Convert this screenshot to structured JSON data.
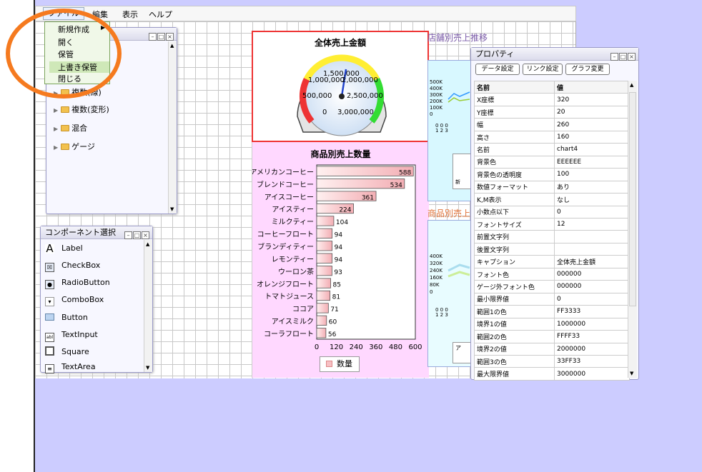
{
  "menubar": {
    "items": [
      "ファイル",
      "編集",
      "表示",
      "ヘルプ"
    ]
  },
  "file_menu": {
    "items": [
      "新規作成",
      "開く",
      "保管",
      "上書き保管",
      "閉じる"
    ],
    "submenu_arrow": "▶"
  },
  "tree_panel": {
    "items": [
      "複数(線)",
      "複数(変形)",
      "混合",
      "ゲージ"
    ]
  },
  "component_panel": {
    "title": "コンポーネント選択",
    "items": [
      {
        "icon": "label-icon",
        "label": "Label"
      },
      {
        "icon": "checkbox-icon",
        "label": "CheckBox"
      },
      {
        "icon": "radiobutton-icon",
        "label": "RadioButton"
      },
      {
        "icon": "combobox-icon",
        "label": "ComboBox"
      },
      {
        "icon": "button-icon",
        "label": "Button"
      },
      {
        "icon": "textinput-icon",
        "label": "TextInput"
      },
      {
        "icon": "square-icon",
        "label": "Square"
      },
      {
        "icon": "textarea-icon",
        "label": "TextArea"
      }
    ]
  },
  "gauge_chart": {
    "title": "全体売上金額",
    "labels": [
      "1,500,000",
      "1,000,000",
      "2,000,000",
      "500,000",
      "2,500,000",
      "0",
      "3,000,000"
    ]
  },
  "bar_chart_title": "商品別売上数量",
  "side_titles": {
    "store_trend": "店舗別売上推移",
    "product_sales": "商品別売上"
  },
  "mini_axis_1": [
    "500K",
    "400K",
    "300K",
    "200K",
    "100K",
    "0"
  ],
  "mini_axis_2": [
    "400K",
    "320K",
    "240K",
    "160K",
    "80K",
    "0"
  ],
  "mini_x_1": "0 0 0 1 2 3",
  "legend_fragment_1": "新",
  "legend_fragment_2": "ア",
  "chart_data": {
    "type": "bar",
    "orientation": "horizontal",
    "title": "商品別売上数量",
    "categories": [
      "アメリカンコーヒー",
      "ブレンドコーヒー",
      "アイスコーヒー",
      "アイスティー",
      "ミルクティー",
      "コーヒーフロート",
      "ブランディティー",
      "レモンティー",
      "ウーロン茶",
      "オレンジフロート",
      "トマトジュース",
      "ココア",
      "アイスミルク",
      "コーラフロート"
    ],
    "series": [
      {
        "name": "数量",
        "values": [
          588,
          534,
          361,
          224,
          104,
          94,
          94,
          94,
          93,
          85,
          81,
          71,
          60,
          56
        ]
      }
    ],
    "xlim": [
      0,
      600
    ],
    "xticks": [
      "0",
      "120",
      "240",
      "360",
      "480",
      "600"
    ],
    "legend": "bottom-center",
    "colors": {
      "bar_start": "#fff0f0",
      "bar_end": "#f3aeb4"
    }
  },
  "properties": {
    "title": "プロパティ",
    "buttons": [
      "データ設定",
      "リンク設定",
      "グラフ変更"
    ],
    "headers": [
      "名前",
      "値"
    ],
    "rows": [
      [
        "X座標",
        "320"
      ],
      [
        "Y座標",
        "20"
      ],
      [
        "幅",
        "260"
      ],
      [
        "高さ",
        "160"
      ],
      [
        "名前",
        "chart4"
      ],
      [
        "背景色",
        "EEEEEE"
      ],
      [
        "背景色の透明度",
        "100"
      ],
      [
        "数値フォーマット",
        "あり"
      ],
      [
        "K,M表示",
        "なし"
      ],
      [
        "小数点以下",
        "0"
      ],
      [
        "フォントサイズ",
        "12"
      ],
      [
        "前置文字列",
        ""
      ],
      [
        "後置文字列",
        ""
      ],
      [
        "キャプション",
        "全体売上金額"
      ],
      [
        "フォント色",
        "000000"
      ],
      [
        "ゲージ外フォント色",
        "000000"
      ],
      [
        "最小限界値",
        "0"
      ],
      [
        "範囲1の色",
        "FF3333"
      ],
      [
        "境界1の値",
        "1000000"
      ],
      [
        "範囲2の色",
        "FFFF33"
      ],
      [
        "境界2の値",
        "2000000"
      ],
      [
        "範囲3の色",
        "33FF33"
      ],
      [
        "最大限界値",
        "3000000"
      ]
    ]
  }
}
